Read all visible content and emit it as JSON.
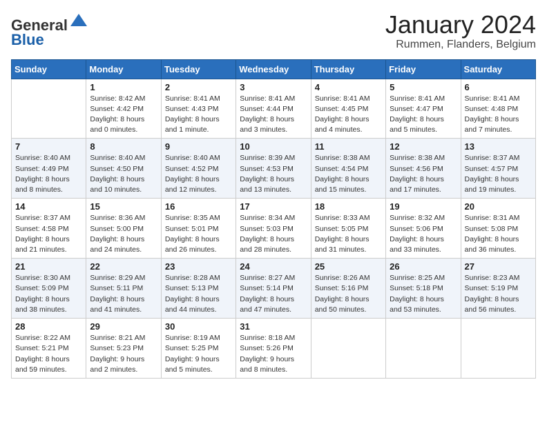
{
  "header": {
    "logo_line1": "General",
    "logo_line2": "Blue",
    "month_title": "January 2024",
    "location": "Rummen, Flanders, Belgium"
  },
  "days_of_week": [
    "Sunday",
    "Monday",
    "Tuesday",
    "Wednesday",
    "Thursday",
    "Friday",
    "Saturday"
  ],
  "weeks": [
    [
      {
        "num": "",
        "info": ""
      },
      {
        "num": "1",
        "info": "Sunrise: 8:42 AM\nSunset: 4:42 PM\nDaylight: 8 hours\nand 0 minutes."
      },
      {
        "num": "2",
        "info": "Sunrise: 8:41 AM\nSunset: 4:43 PM\nDaylight: 8 hours\nand 1 minute."
      },
      {
        "num": "3",
        "info": "Sunrise: 8:41 AM\nSunset: 4:44 PM\nDaylight: 8 hours\nand 3 minutes."
      },
      {
        "num": "4",
        "info": "Sunrise: 8:41 AM\nSunset: 4:45 PM\nDaylight: 8 hours\nand 4 minutes."
      },
      {
        "num": "5",
        "info": "Sunrise: 8:41 AM\nSunset: 4:47 PM\nDaylight: 8 hours\nand 5 minutes."
      },
      {
        "num": "6",
        "info": "Sunrise: 8:41 AM\nSunset: 4:48 PM\nDaylight: 8 hours\nand 7 minutes."
      }
    ],
    [
      {
        "num": "7",
        "info": "Sunrise: 8:40 AM\nSunset: 4:49 PM\nDaylight: 8 hours\nand 8 minutes."
      },
      {
        "num": "8",
        "info": "Sunrise: 8:40 AM\nSunset: 4:50 PM\nDaylight: 8 hours\nand 10 minutes."
      },
      {
        "num": "9",
        "info": "Sunrise: 8:40 AM\nSunset: 4:52 PM\nDaylight: 8 hours\nand 12 minutes."
      },
      {
        "num": "10",
        "info": "Sunrise: 8:39 AM\nSunset: 4:53 PM\nDaylight: 8 hours\nand 13 minutes."
      },
      {
        "num": "11",
        "info": "Sunrise: 8:38 AM\nSunset: 4:54 PM\nDaylight: 8 hours\nand 15 minutes."
      },
      {
        "num": "12",
        "info": "Sunrise: 8:38 AM\nSunset: 4:56 PM\nDaylight: 8 hours\nand 17 minutes."
      },
      {
        "num": "13",
        "info": "Sunrise: 8:37 AM\nSunset: 4:57 PM\nDaylight: 8 hours\nand 19 minutes."
      }
    ],
    [
      {
        "num": "14",
        "info": "Sunrise: 8:37 AM\nSunset: 4:58 PM\nDaylight: 8 hours\nand 21 minutes."
      },
      {
        "num": "15",
        "info": "Sunrise: 8:36 AM\nSunset: 5:00 PM\nDaylight: 8 hours\nand 24 minutes."
      },
      {
        "num": "16",
        "info": "Sunrise: 8:35 AM\nSunset: 5:01 PM\nDaylight: 8 hours\nand 26 minutes."
      },
      {
        "num": "17",
        "info": "Sunrise: 8:34 AM\nSunset: 5:03 PM\nDaylight: 8 hours\nand 28 minutes."
      },
      {
        "num": "18",
        "info": "Sunrise: 8:33 AM\nSunset: 5:05 PM\nDaylight: 8 hours\nand 31 minutes."
      },
      {
        "num": "19",
        "info": "Sunrise: 8:32 AM\nSunset: 5:06 PM\nDaylight: 8 hours\nand 33 minutes."
      },
      {
        "num": "20",
        "info": "Sunrise: 8:31 AM\nSunset: 5:08 PM\nDaylight: 8 hours\nand 36 minutes."
      }
    ],
    [
      {
        "num": "21",
        "info": "Sunrise: 8:30 AM\nSunset: 5:09 PM\nDaylight: 8 hours\nand 38 minutes."
      },
      {
        "num": "22",
        "info": "Sunrise: 8:29 AM\nSunset: 5:11 PM\nDaylight: 8 hours\nand 41 minutes."
      },
      {
        "num": "23",
        "info": "Sunrise: 8:28 AM\nSunset: 5:13 PM\nDaylight: 8 hours\nand 44 minutes."
      },
      {
        "num": "24",
        "info": "Sunrise: 8:27 AM\nSunset: 5:14 PM\nDaylight: 8 hours\nand 47 minutes."
      },
      {
        "num": "25",
        "info": "Sunrise: 8:26 AM\nSunset: 5:16 PM\nDaylight: 8 hours\nand 50 minutes."
      },
      {
        "num": "26",
        "info": "Sunrise: 8:25 AM\nSunset: 5:18 PM\nDaylight: 8 hours\nand 53 minutes."
      },
      {
        "num": "27",
        "info": "Sunrise: 8:23 AM\nSunset: 5:19 PM\nDaylight: 8 hours\nand 56 minutes."
      }
    ],
    [
      {
        "num": "28",
        "info": "Sunrise: 8:22 AM\nSunset: 5:21 PM\nDaylight: 8 hours\nand 59 minutes."
      },
      {
        "num": "29",
        "info": "Sunrise: 8:21 AM\nSunset: 5:23 PM\nDaylight: 9 hours\nand 2 minutes."
      },
      {
        "num": "30",
        "info": "Sunrise: 8:19 AM\nSunset: 5:25 PM\nDaylight: 9 hours\nand 5 minutes."
      },
      {
        "num": "31",
        "info": "Sunrise: 8:18 AM\nSunset: 5:26 PM\nDaylight: 9 hours\nand 8 minutes."
      },
      {
        "num": "",
        "info": ""
      },
      {
        "num": "",
        "info": ""
      },
      {
        "num": "",
        "info": ""
      }
    ]
  ]
}
